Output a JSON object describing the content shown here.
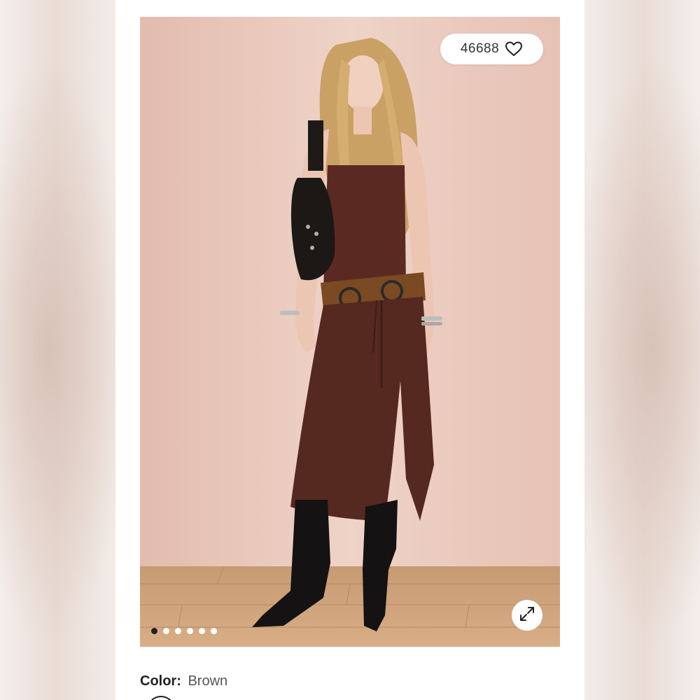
{
  "product": {
    "like_count": "46688",
    "color_label": "Color:",
    "color_value": "Brown",
    "image_count": 6,
    "active_image_index": 0
  },
  "icons": {
    "like": "heart-outline-icon",
    "expand": "expand-arrows-icon"
  },
  "colors": {
    "dot_active": "#222222",
    "dot_inactive": "#ffffff",
    "photo_background": "#e8c9bd",
    "dress": "#5a2a22"
  }
}
